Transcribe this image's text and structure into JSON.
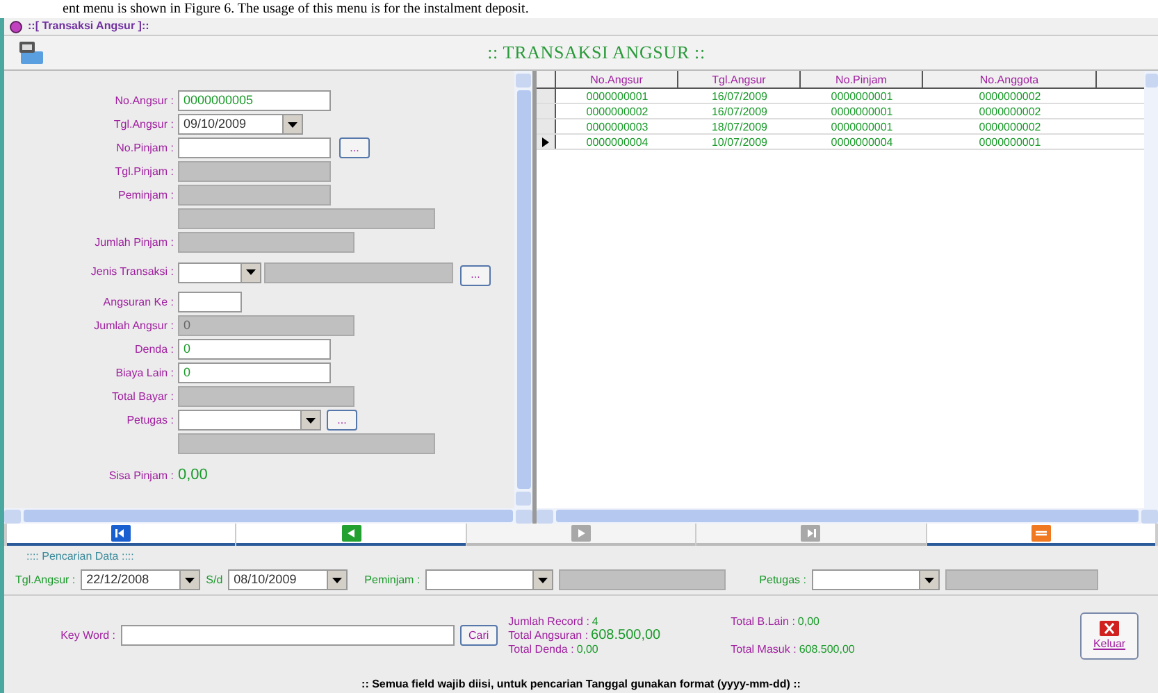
{
  "caption": "ent menu is shown in Figure 6. The usage of this menu is for the instalment deposit.",
  "window": {
    "title": "::[ Transaksi Angsur ]::",
    "heading": ":: TRANSAKSI ANGSUR ::"
  },
  "form": {
    "fields": [
      {
        "label": "No.Angsur :",
        "kind": "text",
        "value": "0000000005"
      },
      {
        "label": "Tgl.Angsur :",
        "kind": "date",
        "value": "09/10/2009"
      },
      {
        "label": "No.Pinjam :",
        "kind": "text_lookup",
        "button": "..."
      },
      {
        "label": "Tgl.Pinjam :",
        "kind": "readonly"
      },
      {
        "label": "Peminjam :",
        "kind": "readonly"
      },
      {
        "kind": "readonly_wide"
      },
      {
        "label": "Jumlah Pinjam :",
        "kind": "readonly_medium"
      },
      {
        "label": "Jenis Transaksi :",
        "kind": "combo_readonly_lookup",
        "button": "..."
      },
      {
        "label": "Angsuran Ke :",
        "kind": "small_text"
      },
      {
        "label": "Jumlah Angsur :",
        "kind": "readonly_medium",
        "value": "0"
      },
      {
        "label": "Denda :",
        "kind": "text",
        "value": "0"
      },
      {
        "label": "Biaya Lain :",
        "kind": "text",
        "value": "0"
      },
      {
        "label": "Total Bayar :",
        "kind": "readonly_medium"
      },
      {
        "label": "Petugas :",
        "kind": "combo_lookup",
        "button": "..."
      },
      {
        "kind": "readonly_wide"
      },
      {
        "label": "Sisa Pinjam :",
        "kind": "amount",
        "value": "0,00"
      }
    ]
  },
  "table": {
    "columns": [
      "No.Angsur",
      "Tgl.Angsur",
      "No.Pinjam",
      "No.Anggota"
    ],
    "rows": [
      {
        "cells": [
          "0000000001",
          "16/07/2009",
          "0000000001",
          "0000000002"
        ],
        "selected": false
      },
      {
        "cells": [
          "0000000002",
          "16/07/2009",
          "0000000001",
          "0000000002"
        ],
        "selected": false
      },
      {
        "cells": [
          "0000000003",
          "18/07/2009",
          "0000000001",
          "0000000002"
        ],
        "selected": false
      },
      {
        "cells": [
          "0000000004",
          "10/07/2009",
          "0000000004",
          "0000000001"
        ],
        "selected": true
      }
    ]
  },
  "navigation": [
    {
      "kind": "first",
      "disabled": false
    },
    {
      "kind": "previous",
      "disabled": false
    },
    {
      "kind": "next",
      "disabled": true
    },
    {
      "kind": "last",
      "disabled": true
    },
    {
      "kind": "refresh",
      "disabled": false
    }
  ],
  "search": {
    "title": ":::: Pencarian Data ::::",
    "date_label": "Tgl.Angsur :",
    "date_from": "22/12/2008",
    "date_to_label": "S/d",
    "date_to": "08/10/2009",
    "peminjam_label": "Peminjam :",
    "petugas_label": "Petugas :",
    "keyword_label": "Key Word :",
    "search_button": "Cari",
    "summary": [
      {
        "label": "Jumlah Record :",
        "value": "4"
      },
      {
        "label": "Total Angsuran :",
        "value": "608.500,00",
        "large": true
      },
      {
        "label": "Total Denda :",
        "value": "0,00"
      },
      {
        "label": "Total B.Lain :",
        "value": "0,00"
      },
      {
        "label": "Total Masuk :",
        "value": "608.500,00"
      }
    ],
    "close_button": "Keluar"
  },
  "footer": ":: Semua field wajib diisi, untuk pencarian Tanggal gunakan format (yyyy-mm-dd) ::"
}
